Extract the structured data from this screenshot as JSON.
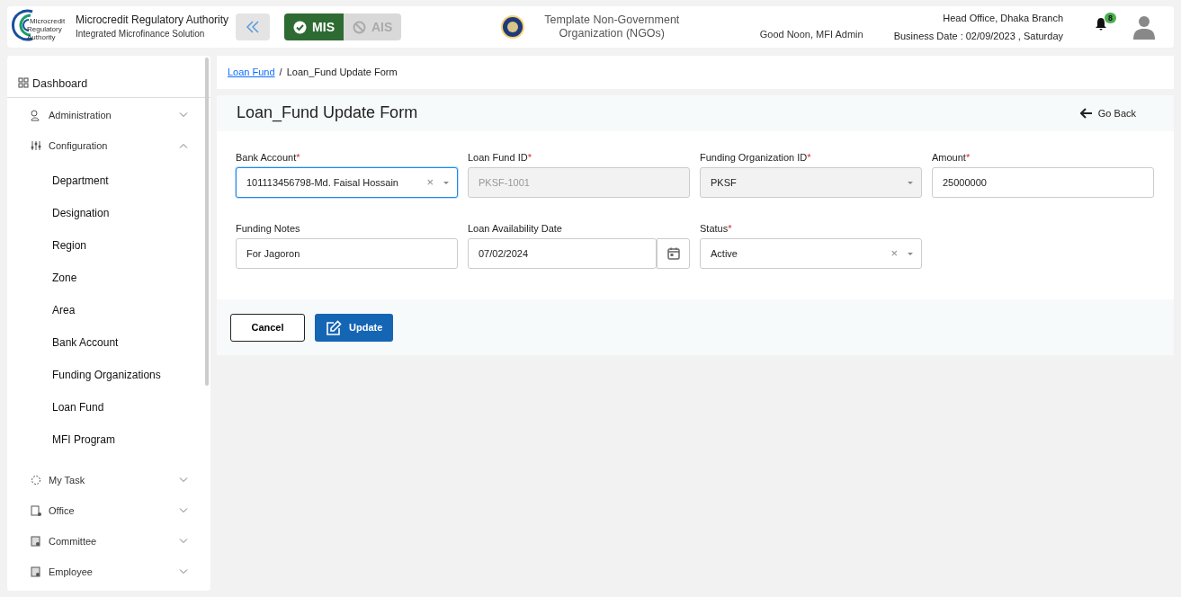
{
  "header": {
    "logo_caption": [
      "Microcredit",
      "Regulatory",
      "Authority"
    ],
    "title": "Microcredit Regulatory Authority",
    "subtitle": "Integrated Microfinance Solution",
    "modules": [
      {
        "label": "MIS",
        "selected": true,
        "disabled": false
      },
      {
        "label": "AIS",
        "selected": false,
        "disabled": true
      }
    ],
    "organization": "Template Non-Government Organization (NGOs)",
    "greeting": "Good Noon, MFI Admin",
    "branch": "Head Office, Dhaka Branch",
    "business_date": "Business Date : 02/09/2023 , Saturday",
    "notification_count": "8"
  },
  "sidebar": {
    "items": [
      {
        "kind": "top",
        "label": "Dashboard"
      },
      {
        "kind": "group",
        "label": "Administration",
        "expanded": false
      },
      {
        "kind": "group",
        "label": "Configuration",
        "expanded": true,
        "children": [
          {
            "label": "Department"
          },
          {
            "label": "Designation"
          },
          {
            "label": "Region"
          },
          {
            "label": "Zone"
          },
          {
            "label": "Area"
          },
          {
            "label": "Bank Account"
          },
          {
            "label": "Funding Organizations"
          },
          {
            "label": "Loan Fund"
          },
          {
            "label": "MFI Program"
          }
        ]
      },
      {
        "kind": "group",
        "label": "My Task",
        "expanded": false
      },
      {
        "kind": "group",
        "label": "Office",
        "expanded": false
      },
      {
        "kind": "group",
        "label": "Committee",
        "expanded": false
      },
      {
        "kind": "group",
        "label": "Employee",
        "expanded": false
      }
    ]
  },
  "breadcrumb": [
    {
      "label": "Loan Fund",
      "link": true
    },
    {
      "separator": "/",
      "label": "Loan_Fund Update Form",
      "link": false
    }
  ],
  "form": {
    "title": "Loan_Fund Update Form",
    "back": "Go Back",
    "fields": [
      {
        "kind": "select",
        "label": "Bank Account",
        "required_mark": "*",
        "value": "101113456798-Md. Faisal Hossain",
        "clear_icon": "×",
        "focused": true,
        "disabled": false
      },
      {
        "kind": "text",
        "label": "Loan Fund ID",
        "required_mark": "*",
        "value": "PKSF-1001",
        "focused": false,
        "disabled": true
      },
      {
        "kind": "select",
        "label": "Funding Organization ID",
        "required_mark": "*",
        "value": "PKSF",
        "focused": false,
        "disabled": true
      },
      {
        "kind": "text",
        "label": "Amount",
        "required_mark": "*",
        "value": "25000000",
        "focused": false,
        "disabled": false
      },
      {
        "kind": "text",
        "label": "Funding Notes",
        "value": "For Jagoron",
        "focused": false,
        "disabled": false
      },
      {
        "kind": "date",
        "label": "Loan Availability Date",
        "value": "07/02/2024",
        "focused": false,
        "disabled": false
      },
      {
        "kind": "select",
        "label": "Status",
        "required_mark": "*",
        "value": "Active",
        "clear_icon": "×",
        "focused": false,
        "disabled": false
      }
    ],
    "buttons": [
      {
        "kind": "cancel",
        "label": "Cancel"
      },
      {
        "kind": "update",
        "label": "Update"
      }
    ]
  }
}
